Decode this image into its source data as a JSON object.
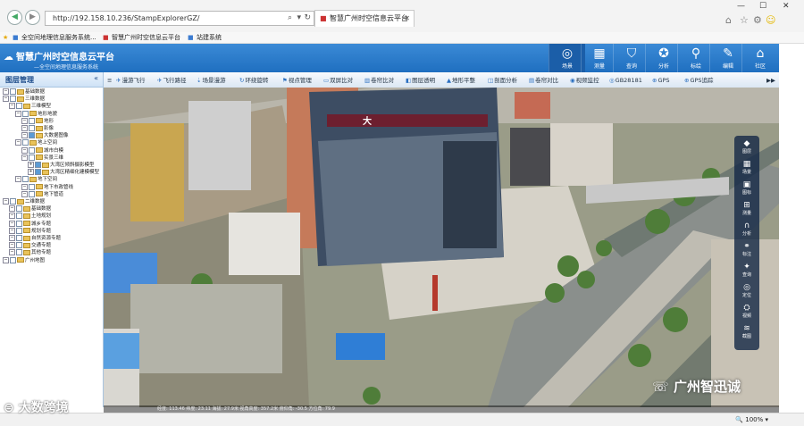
{
  "browser": {
    "url": "http://192.158.10.236/StampExplorerGZ/",
    "tab_title": "智慧广州时空信息云平台",
    "favorites": [
      "全空间地理信息服务系统...",
      "智慧广州时空信息云平台",
      "站建系统"
    ],
    "zoom": "100%"
  },
  "app": {
    "title": "智慧广州时空信息云平台",
    "subtitle": "—全空间地理信息服务系统",
    "nav": [
      "场景",
      "测量",
      "查询",
      "分析",
      "标绘",
      "编辑",
      "社区"
    ]
  },
  "left": {
    "title": "图层管理",
    "tree": [
      {
        "label": "基础数据",
        "level": 0
      },
      {
        "label": "三维数据",
        "level": 0
      },
      {
        "label": "三维模型",
        "level": 1
      },
      {
        "label": "地形地貌",
        "level": 2
      },
      {
        "label": "地形",
        "level": 3
      },
      {
        "label": "影像",
        "level": 3
      },
      {
        "label": "大数据图像",
        "level": 3
      },
      {
        "label": "地上空间",
        "level": 2
      },
      {
        "label": "城市白模",
        "level": 3
      },
      {
        "label": "实景三维",
        "level": 3
      },
      {
        "label": "大湾区倾斜摄影模型",
        "level": 4
      },
      {
        "label": "大湾区精细化建模模型",
        "level": 4
      },
      {
        "label": "地下空间",
        "level": 2
      },
      {
        "label": "地下市政管线",
        "level": 3
      },
      {
        "label": "地下管道",
        "level": 3
      },
      {
        "label": "二维数据",
        "level": 0
      },
      {
        "label": "基础数据",
        "level": 1
      },
      {
        "label": "土地规划",
        "level": 1
      },
      {
        "label": "城乡专题",
        "level": 1
      },
      {
        "label": "规划专题",
        "level": 1
      },
      {
        "label": "自然资源专题",
        "level": 1
      },
      {
        "label": "交通专题",
        "level": 1
      },
      {
        "label": "其他专题",
        "level": 1
      },
      {
        "label": "广州地图",
        "level": 0
      }
    ]
  },
  "toolbar": [
    "漫游飞行",
    "飞行路径",
    "场景漫游",
    "环绕旋转",
    "视点管理",
    "双屏比对",
    "卷帘比对",
    "图层透明",
    "地形平整",
    "剖面分析",
    "卷帘对比",
    "视频监控",
    "GB28181",
    "GPS",
    "GPS追踪"
  ],
  "right_tools": [
    "图层",
    "场景",
    "图标",
    "测量",
    "分析",
    "标注",
    "查询",
    "定位",
    "视频",
    "截图"
  ],
  "status": "经度: 113.46   纬度: 23.11   海拔: 27.9米   视角高度: 357.2米   俯仰角: -30.5   方位角: 79.9",
  "watermarks": {
    "left": "大数跨境",
    "right": "广州智迅诚"
  }
}
